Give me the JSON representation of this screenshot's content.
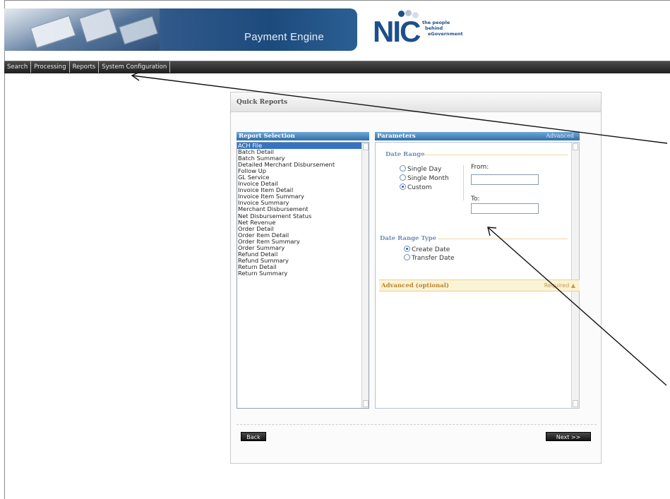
{
  "header": {
    "app_title": "Payment Engine",
    "logo_text": "NIC",
    "logo_tagline": [
      "the people",
      "behind",
      "eGovernment"
    ]
  },
  "nav": {
    "items": [
      {
        "label": "Search"
      },
      {
        "label": "Processing"
      },
      {
        "label": "Reports"
      },
      {
        "label": "System Configuration"
      }
    ]
  },
  "panel": {
    "title": "Quick Reports",
    "report_selection": {
      "heading": "Report Selection",
      "items": [
        "ACH File",
        "Batch Detail",
        "Batch Summary",
        "Detailed Merchant Disbursement",
        "Follow Up",
        "GL Service",
        "Invoice Detail",
        "Invoice Item Detail",
        "Invoice Item Summary",
        "Invoice Summary",
        "Merchant Disbursement",
        "Net Disbursement Status",
        "Net Revenue",
        "Order Detail",
        "Order Item Detail",
        "Order Item Summary",
        "Order Summary",
        "Refund Detail",
        "Refund Summary",
        "Return Detail",
        "Return Summary"
      ],
      "selected": "ACH File"
    },
    "parameters": {
      "heading": "Parameters",
      "advanced_link": "Advanced",
      "date_range": {
        "title": "Date Range",
        "options": [
          "Single Day",
          "Single Month",
          "Custom"
        ],
        "selected": "Custom",
        "from_label": "From:",
        "from_value": "",
        "to_label": "To:",
        "to_value": ""
      },
      "date_range_type": {
        "title": "Date Range Type",
        "options": [
          "Create Date",
          "Transfer Date"
        ],
        "selected": "Create Date"
      },
      "advanced": {
        "title": "Advanced (optional)",
        "required_label": "Required"
      }
    },
    "buttons": {
      "back": "Back",
      "next": "Next >>"
    }
  },
  "colors": {
    "accent": "#2f6fa8",
    "selection": "#3673c1",
    "navbar": "#1e1e1e",
    "advanced_bar": "#fbf3d6"
  }
}
